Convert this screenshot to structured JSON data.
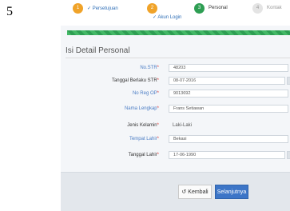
{
  "page_number": "5",
  "steps": [
    {
      "num": "1",
      "label": "✓ Persetujuan",
      "state": "done"
    },
    {
      "num": "2",
      "label": "✓ Akun Login",
      "state": "done"
    },
    {
      "num": "3",
      "label": "Personal",
      "state": "active"
    },
    {
      "num": "4",
      "label": "Kontak",
      "state": "todo"
    }
  ],
  "progress_percent": 100,
  "form_title": "Isi Detail Personal",
  "fields": [
    {
      "label": "No.STR",
      "value": "48203",
      "type": "input"
    },
    {
      "label": "Tanggal Berlaku STR",
      "value": "08-07-2016",
      "type": "date"
    },
    {
      "label": "No Reg OP",
      "value": "9013692",
      "type": "input"
    },
    {
      "label": "Nama Lengkap",
      "value": "Frans Setiawan",
      "type": "input"
    },
    {
      "label": "Jenis Kelamin",
      "value": "Laki-Laki",
      "type": "text"
    },
    {
      "label": "Tempat Lahir",
      "value": "Bekasi",
      "type": "input"
    },
    {
      "label": "Tanggal Lahir",
      "value": "17-06-1990",
      "type": "date"
    }
  ],
  "required_mark": "*",
  "buttons": {
    "back": "Kembali",
    "next": "Selanjutnya"
  },
  "colors": {
    "accent": "#3c75c7",
    "done_step": "#f0a329",
    "active_step": "#2e9e53",
    "progress": "#43b866"
  }
}
